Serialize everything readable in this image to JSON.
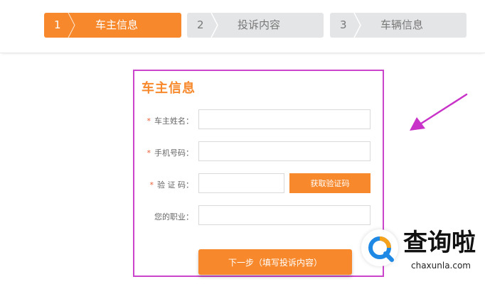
{
  "steps": [
    {
      "num": "1",
      "label": "车主信息",
      "active": true
    },
    {
      "num": "2",
      "label": "投诉内容",
      "active": false
    },
    {
      "num": "3",
      "label": "车辆信息",
      "active": false
    }
  ],
  "form": {
    "title": "车主信息",
    "required_mark": "*",
    "fields": [
      {
        "label": "车主姓名：",
        "required": true,
        "value": ""
      },
      {
        "label": "手机号码：",
        "required": true,
        "value": ""
      },
      {
        "label": "验 证 码：",
        "required": true,
        "value": ""
      },
      {
        "label": "您的职业：",
        "required": false,
        "value": ""
      }
    ],
    "get_code_button": "获取验证码",
    "next_button": "下一步（填写投诉内容）"
  },
  "watermark": {
    "brand": "查询啦",
    "domain": "chaxunla.com"
  },
  "colors": {
    "accent": "#f7892c",
    "highlight_border": "#cc44cc",
    "arrow": "#c832c8",
    "inactive_step": "#e4e5e7"
  }
}
